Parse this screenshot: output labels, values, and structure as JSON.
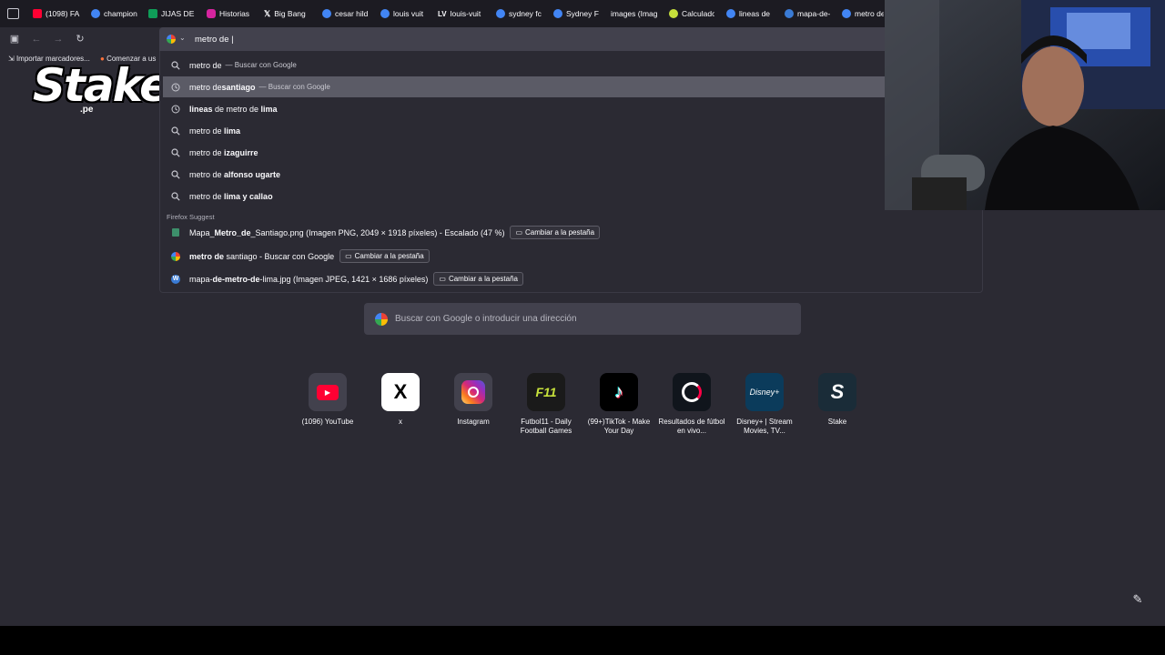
{
  "tabs": [
    {
      "label": "(1098) FA",
      "color": "#ff0033"
    },
    {
      "label": "champion",
      "color": "#4285f4"
    },
    {
      "label": "JIJAS DE I",
      "color": "#0f9d58"
    },
    {
      "label": "Historias",
      "color": "#d6249f"
    },
    {
      "label": "Big Bang",
      "color": "#ffffff"
    },
    {
      "label": "cesar hild",
      "color": "#4285f4"
    },
    {
      "label": "louis vuit",
      "color": "#4285f4"
    },
    {
      "label": "louis-vuit",
      "color": "#ffffff"
    },
    {
      "label": "sydney fc",
      "color": "#4285f4"
    },
    {
      "label": "Sydney FC",
      "color": "#4285f4"
    },
    {
      "label": "images (Imag",
      "color": "#2b2a33"
    },
    {
      "label": "Calculado",
      "color": "#c6e03b"
    },
    {
      "label": "lineas de",
      "color": "#4285f4"
    },
    {
      "label": "mapa-de-",
      "color": "#3a7bd5"
    },
    {
      "label": "metro de",
      "color": "#4285f4"
    }
  ],
  "urlbar": {
    "value": "metro de |"
  },
  "bookmarks": [
    {
      "label": "Importar marcadores..."
    },
    {
      "label": "Comenzar a us"
    }
  ],
  "suggestions": [
    {
      "pre": "metro de",
      "bold": "",
      "tail": "",
      "sub": "— Buscar con Google",
      "icon": "search"
    },
    {
      "pre": "metro de ",
      "bold": "santiago",
      "tail": "",
      "sub": "— Buscar con Google",
      "icon": "history"
    },
    {
      "pre": "",
      "bold": "lineas",
      "tail": " de metro de ",
      "bold2": "lima",
      "sub": "",
      "icon": "history"
    },
    {
      "pre": "metro de ",
      "bold": "lima",
      "tail": "",
      "sub": "",
      "icon": "search"
    },
    {
      "pre": "metro de ",
      "bold": "izaguirre",
      "tail": "",
      "sub": "",
      "icon": "search"
    },
    {
      "pre": "metro de ",
      "bold": "alfonso ugarte",
      "tail": "",
      "sub": "",
      "icon": "search"
    },
    {
      "pre": "metro de ",
      "bold": "lima y callao",
      "tail": "",
      "sub": "",
      "icon": "search"
    }
  ],
  "suggest_section": "Firefox Suggest",
  "suggest_rows": [
    {
      "pre": "Mapa_",
      "bold": "Metro_de",
      "tail": "_Santiago.png (Imagen PNG, 2049 × 1918 píxeles) - Escalado (47 %)",
      "switch": "Cambiar a la pestaña"
    },
    {
      "pre": "",
      "bold": "metro de",
      "tail": " santiago - Buscar con Google",
      "switch": "Cambiar a la pestaña"
    },
    {
      "pre": "mapa-",
      "bold": "de-metro-de",
      "tail": "-lima.jpg (Imagen JPEG, 1421 × 1686 píxeles)",
      "switch": "Cambiar a la pestaña"
    }
  ],
  "newtab": {
    "search_placeholder": "Buscar con Google o introducir una dirección"
  },
  "shortcuts": [
    {
      "label": "(1096) YouTube",
      "icon": "youtube-icon"
    },
    {
      "label": "x",
      "icon": "x-icon"
    },
    {
      "label": "Instagram",
      "icon": "instagram-icon"
    },
    {
      "label": "Futbol11 - Daily Football Games",
      "icon": "futbol11-icon"
    },
    {
      "label": "(99+)TikTok - Make Your Day",
      "icon": "tiktok-icon"
    },
    {
      "label": "Resultados de fútbol en vivo...",
      "icon": "flashscore-icon"
    },
    {
      "label": "Disney+ | Stream Movies, TV...",
      "icon": "disney-icon"
    },
    {
      "label": "Stake",
      "icon": "stake-icon"
    }
  ],
  "overlay_logo": {
    "main": "Stake",
    "sub": ".pe"
  }
}
